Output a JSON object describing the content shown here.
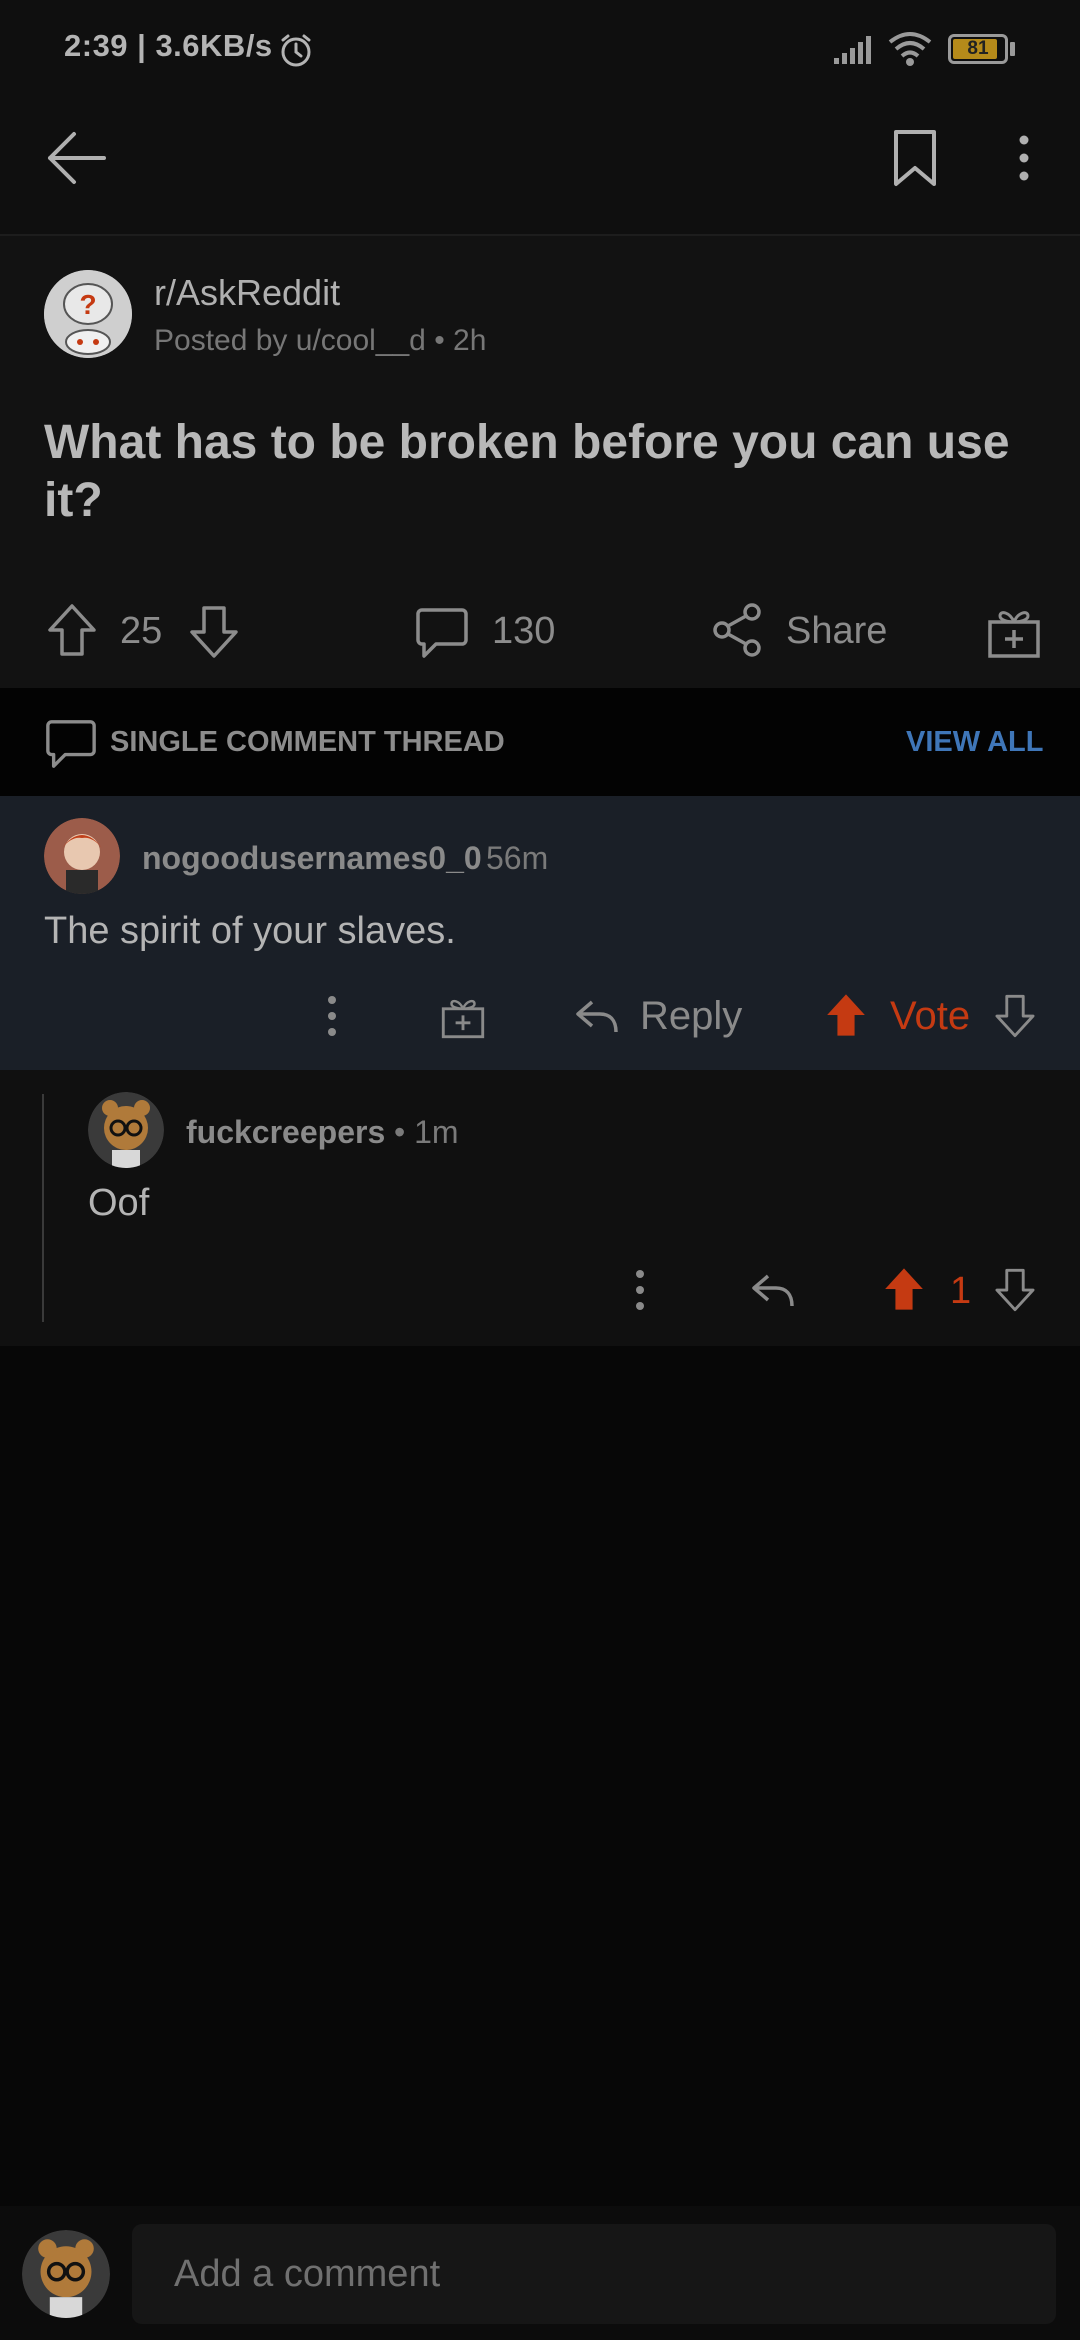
{
  "status_bar": {
    "time_speed": "2:39 | 3.6KB/s",
    "battery": "81"
  },
  "post": {
    "subreddit": "r/AskReddit",
    "meta": "Posted by u/cool__d • 2h",
    "title": "What has to be broken before you can use it?",
    "votes": "25",
    "comments": "130",
    "share_label": "Share"
  },
  "thread": {
    "label": "SINGLE COMMENT THREAD",
    "view_all": "VIEW ALL"
  },
  "comments": [
    {
      "user": "nogoodusernames0_0",
      "time": "56m",
      "body": "The spirit of your slaves.",
      "reply_label": "Reply",
      "vote_label": "Vote"
    },
    {
      "user": "fuckcreepers",
      "time": "• 1m",
      "body": "Oof",
      "votes": "1"
    }
  ],
  "composer": {
    "placeholder": "Add a comment"
  },
  "colors": {
    "accent_upvote": "#c53a12",
    "link_blue": "#3f76b8",
    "highlight_bg": "#1a1f27"
  },
  "icons": [
    "back-arrow-icon",
    "bookmark-icon",
    "more-vertical-icon",
    "upvote-icon",
    "downvote-icon",
    "comment-icon",
    "share-icon",
    "award-icon",
    "reply-icon",
    "signal-icon",
    "wifi-icon",
    "alarm-icon",
    "battery-icon"
  ]
}
